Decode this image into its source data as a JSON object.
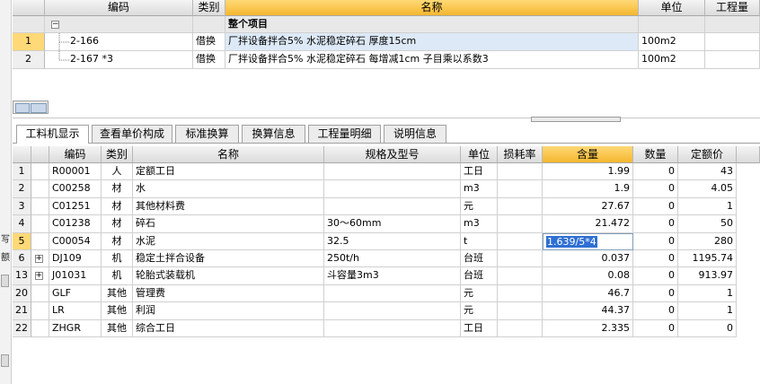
{
  "top_grid": {
    "headers": [
      "编码",
      "类别",
      "名称",
      "单位",
      "工程量"
    ],
    "group_row": {
      "toggle": "−",
      "name": "整个项目"
    },
    "rows": [
      {
        "num": "1",
        "code": "2-166",
        "type": "借换",
        "name": "厂拌设备拌合5% 水泥稳定碎石 厚度15cm",
        "unit": "100m2"
      },
      {
        "num": "2",
        "code": "2-167 *3",
        "type": "借换",
        "name": "厂拌设备拌合5% 水泥稳定碎石 每增减1cm 子目乘以系数3",
        "unit": "100m2"
      }
    ]
  },
  "tabs": [
    "工料机显示",
    "查看单价构成",
    "标准换算",
    "换算信息",
    "工程量明细",
    "说明信息"
  ],
  "bottom_grid": {
    "headers": [
      "编码",
      "类别",
      "名称",
      "规格及型号",
      "单位",
      "损耗率",
      "含量",
      "数量",
      "定额价"
    ],
    "rows": [
      {
        "num": "1",
        "exp": "",
        "code": "R00001",
        "type": "人",
        "name": "定额工日",
        "spec": "",
        "unit": "工日",
        "loss": "",
        "qty": "1.99",
        "amount": "0",
        "price": "43"
      },
      {
        "num": "2",
        "exp": "",
        "code": "C00258",
        "type": "材",
        "name": "水",
        "spec": "",
        "unit": "m3",
        "loss": "",
        "qty": "1.9",
        "amount": "0",
        "price": "4.05"
      },
      {
        "num": "3",
        "exp": "",
        "code": "C01251",
        "type": "材",
        "name": "其他材料费",
        "spec": "",
        "unit": "元",
        "loss": "",
        "qty": "27.67",
        "amount": "0",
        "price": "1"
      },
      {
        "num": "4",
        "exp": "",
        "code": "C01238",
        "type": "材",
        "name": "碎石",
        "spec": "30～60mm",
        "unit": "m3",
        "loss": "",
        "qty": "21.472",
        "amount": "0",
        "price": "50"
      },
      {
        "num": "5",
        "exp": "",
        "code": "C00054",
        "type": "材",
        "name": "水泥",
        "spec": "32.5",
        "unit": "t",
        "loss": "",
        "qty": "1.639/5*4",
        "amount": "0",
        "price": "280"
      },
      {
        "num": "6",
        "exp": "+",
        "code": "DJ109",
        "type": "机",
        "name": "稳定土拌合设备",
        "spec": "250t/h",
        "unit": "台班",
        "loss": "",
        "qty": "0.037",
        "amount": "0",
        "price": "1195.74"
      },
      {
        "num": "13",
        "exp": "+",
        "code": "J01031",
        "type": "机",
        "name": "轮胎式装载机",
        "spec": "斗容量3m3",
        "unit": "台班",
        "loss": "",
        "qty": "0.08",
        "amount": "0",
        "price": "913.97"
      },
      {
        "num": "20",
        "exp": "",
        "code": "GLF",
        "type": "其他",
        "name": "管理费",
        "spec": "",
        "unit": "元",
        "loss": "",
        "qty": "46.7",
        "amount": "0",
        "price": "1"
      },
      {
        "num": "21",
        "exp": "",
        "code": "LR",
        "type": "其他",
        "name": "利润",
        "spec": "",
        "unit": "元",
        "loss": "",
        "qty": "44.37",
        "amount": "0",
        "price": "1"
      },
      {
        "num": "22",
        "exp": "",
        "code": "ZHGR",
        "type": "其他",
        "name": "综合工日",
        "spec": "",
        "unit": "工日",
        "loss": "",
        "qty": "2.335",
        "amount": "0",
        "price": "0"
      }
    ]
  },
  "left_strip": {
    "tick1": "写",
    "tick2": "额"
  },
  "colors": {
    "selected_header": "#f5b62e",
    "edit_highlight": "#2f6fd3",
    "selected_row": "#dde9f7"
  }
}
